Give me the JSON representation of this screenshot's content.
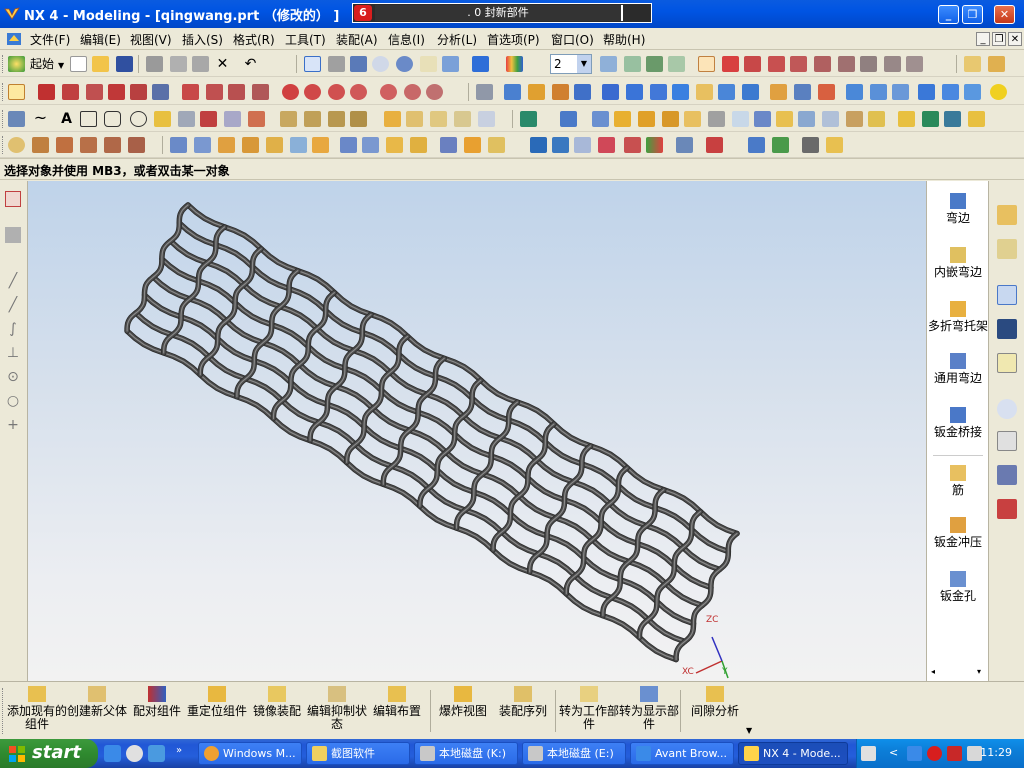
{
  "window": {
    "title": "NX 4 - Modeling - [qingwang.prt （修改的） ]",
    "status_message": ". 0 封新部件"
  },
  "menu": [
    "文件(F)",
    "编辑(E)",
    "视图(V)",
    "插入(S)",
    "格式(R)",
    "工具(T)",
    "装配(A)",
    "信息(I)",
    "分析(L)",
    "首选项(P)",
    "窗口(O)",
    "帮助(H)"
  ],
  "toolbar": {
    "start_label": "起始",
    "layer_value": "2"
  },
  "prompt": "选择对象并使用 MB3，或者双击某一对象",
  "sheetmetal_panel": [
    {
      "label": "弯边",
      "icon": "flange-icon"
    },
    {
      "label": "内嵌弯边",
      "icon": "inset-flange-icon"
    },
    {
      "label": "多折弯托架",
      "icon": "multi-bend-bracket-icon"
    },
    {
      "label": "通用弯边",
      "icon": "general-flange-icon"
    },
    {
      "label": "钣金桥接",
      "icon": "sheetmetal-bridge-icon"
    },
    {
      "label": "筋",
      "icon": "bead-icon"
    },
    {
      "label": "钣金冲压",
      "icon": "sheetmetal-punch-icon"
    },
    {
      "label": "钣金孔",
      "icon": "sheetmetal-hole-icon"
    }
  ],
  "assembly_toolbar": [
    {
      "label": "添加现有的组件",
      "icon": "add-component-icon"
    },
    {
      "label": "创建新父体",
      "icon": "create-parent-icon"
    },
    {
      "label": "配对组件",
      "icon": "mate-component-icon"
    },
    {
      "label": "重定位组件",
      "icon": "reposition-component-icon"
    },
    {
      "label": "镜像装配",
      "icon": "mirror-assembly-icon"
    },
    {
      "label": "编辑抑制状态",
      "icon": "edit-suppression-icon"
    },
    {
      "label": "编辑布置",
      "icon": "edit-arrangement-icon"
    },
    {
      "label": "爆炸视图",
      "icon": "exploded-view-icon"
    },
    {
      "label": "装配序列",
      "icon": "assembly-sequence-icon"
    },
    {
      "label": "转为工作部件",
      "icon": "make-work-part-icon"
    },
    {
      "label": "转为显示部件",
      "icon": "make-displayed-part-icon"
    },
    {
      "label": "间隙分析",
      "icon": "clearance-analysis-icon"
    }
  ],
  "triad": {
    "x": "XC",
    "y": "Y",
    "z": "ZC"
  },
  "taskbar": {
    "start_label": "start",
    "tasks": [
      {
        "label": "Windows M...",
        "icon": "media-player-icon"
      },
      {
        "label": "截图软件",
        "icon": "folder-icon"
      },
      {
        "label": "本地磁盘 (K:)",
        "icon": "drive-icon"
      },
      {
        "label": "本地磁盘 (E:)",
        "icon": "drive-icon"
      },
      {
        "label": "Avant Brow...",
        "icon": "browser-icon"
      },
      {
        "label": "NX 4 - Mode...",
        "icon": "nx-icon"
      }
    ],
    "clock": "11:29"
  },
  "colors": {
    "titlebar": "#0054e3",
    "mesh": "#4a4a4a",
    "viewport_top": "#bfd3ea",
    "viewport_bottom": "#f2f2f2"
  }
}
